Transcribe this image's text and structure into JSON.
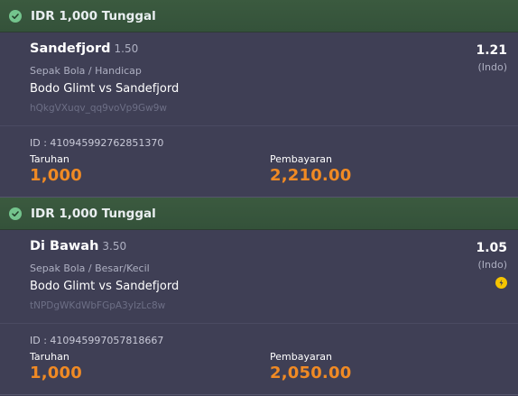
{
  "bets": [
    {
      "header": "IDR 1,000 Tunggal",
      "selection": "Sandefjord",
      "handicap": "1.50",
      "odds": "1.21",
      "odds_type": "(Indo)",
      "sport_market": "Sepak Bola / Handicap",
      "match": "Bodo Glimt vs Sandefjord",
      "code": "hQkgVXuqv_qq9voVp9Gw9w",
      "id_text": "ID : 410945992762851370",
      "stake_label": "Taruhan",
      "stake": "1,000",
      "payout_label": "Pembayaran",
      "payout": "2,210.00"
    },
    {
      "header": "IDR 1,000 Tunggal",
      "selection": "Di Bawah",
      "handicap": "3.50",
      "odds": "1.05",
      "odds_type": "(Indo)",
      "sport_market": "Sepak Bola / Besar/Kecil",
      "match": "Bodo Glimt vs Sandefjord",
      "code": "tNPDgWKdWbFGpA3ylzLc8w",
      "id_text": "ID : 410945997057818667",
      "stake_label": "Taruhan",
      "stake": "1,000",
      "payout_label": "Pembayaran",
      "payout": "2,050.00"
    }
  ],
  "colors": {
    "header_bg": "#3b5a3f",
    "panel_bg": "#3f3f55",
    "accent": "#f08a24",
    "check": "#74c48d",
    "live_badge": "#f5c400"
  },
  "icons": {
    "check": "check-circle-icon",
    "live": "live-bolt-icon"
  }
}
